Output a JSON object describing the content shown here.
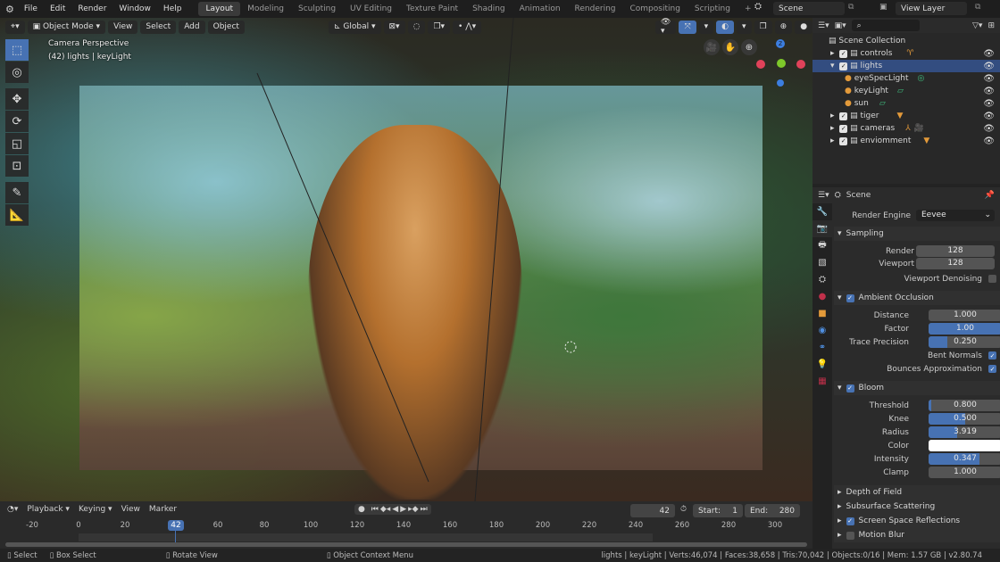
{
  "topbar": {
    "menus": [
      "File",
      "Edit",
      "Render",
      "Window",
      "Help"
    ],
    "workspaces": [
      "Layout",
      "Modeling",
      "Sculpting",
      "UV Editing",
      "Texture Paint",
      "Shading",
      "Animation",
      "Rendering",
      "Compositing",
      "Scripting"
    ],
    "active_workspace": "Layout",
    "add_tab": "+",
    "scene": "Scene",
    "view_layer": "View Layer"
  },
  "viewport": {
    "mode": "Object Mode",
    "menus": [
      "View",
      "Select",
      "Add",
      "Object"
    ],
    "orientation": "Global",
    "overlay_title": "Camera Perspective",
    "overlay_subtitle": "(42) lights | keyLight",
    "gizmo_axes": {
      "z": "Z"
    },
    "axis_colors": {
      "x": "#e0425a",
      "y": "#7ec82a",
      "z": "#3c7ee0"
    }
  },
  "outliner": {
    "search_placeholder": "",
    "root": "Scene Collection",
    "items": [
      {
        "name": "controls",
        "level": 1,
        "expanded": false,
        "checked": true,
        "selected": false
      },
      {
        "name": "lights",
        "level": 1,
        "expanded": true,
        "checked": true,
        "selected": true
      },
      {
        "name": "eyeSpecLight",
        "level": 2
      },
      {
        "name": "keyLight",
        "level": 2
      },
      {
        "name": "sun",
        "level": 2
      },
      {
        "name": "tiger",
        "level": 1,
        "expanded": false,
        "checked": true,
        "selected": false
      },
      {
        "name": "cameras",
        "level": 1,
        "expanded": false,
        "checked": true,
        "selected": false
      },
      {
        "name": "enviomment",
        "level": 1,
        "expanded": false,
        "checked": true,
        "selected": false
      }
    ]
  },
  "properties": {
    "context": "Scene",
    "render_engine_label": "Render Engine",
    "render_engine": "Eevee",
    "sampling": {
      "title": "Sampling",
      "render_label": "Render",
      "render": "128",
      "viewport_label": "Viewport",
      "viewport": "128",
      "denoise_label": "Viewport Denoising",
      "denoise": false
    },
    "ao": {
      "title": "Ambient Occlusion",
      "enabled": true,
      "distance_label": "Distance",
      "distance": "1.000",
      "factor_label": "Factor",
      "factor": "1.00",
      "factor_fill": 1.0,
      "trace_label": "Trace Precision",
      "trace": "0.250",
      "trace_fill": 0.25,
      "bent_label": "Bent Normals",
      "bent": true,
      "bounces_label": "Bounces Approximation",
      "bounces": true
    },
    "bloom": {
      "title": "Bloom",
      "enabled": true,
      "threshold_label": "Threshold",
      "threshold": "0.800",
      "threshold_fill": 0.04,
      "knee_label": "Knee",
      "knee": "0.500",
      "knee_fill": 0.5,
      "radius_label": "Radius",
      "radius": "3.919",
      "radius_fill": 0.39,
      "color_label": "Color",
      "color": "#ffffff",
      "intensity_label": "Intensity",
      "intensity": "0.347",
      "intensity_fill": 0.69,
      "clamp_label": "Clamp",
      "clamp": "1.000"
    },
    "collapsed": [
      {
        "title": "Depth of Field"
      },
      {
        "title": "Subsurface Scattering"
      },
      {
        "title": "Screen Space Reflections",
        "checkbox": true,
        "enabled": true
      },
      {
        "title": "Motion Blur",
        "checkbox": true,
        "enabled": false
      }
    ]
  },
  "timeline": {
    "menus": [
      "Playback",
      "Keying",
      "View",
      "Marker"
    ],
    "current_frame": "42",
    "start_label": "Start:",
    "start": "1",
    "end_label": "End:",
    "end": "280",
    "ticks": [
      "-20",
      "0",
      "20",
      "60",
      "80",
      "100",
      "120",
      "140",
      "160",
      "180",
      "200",
      "220",
      "240",
      "260",
      "280",
      "300"
    ]
  },
  "statusbar": {
    "select": "Select",
    "box_select": "Box Select",
    "rotate": "Rotate View",
    "context_menu": "Object Context Menu",
    "stats": "lights | keyLight | Verts:46,074 | Faces:38,658 | Tris:70,042 | Objects:0/16 | Mem: 1.57 GB | v2.80.74"
  }
}
